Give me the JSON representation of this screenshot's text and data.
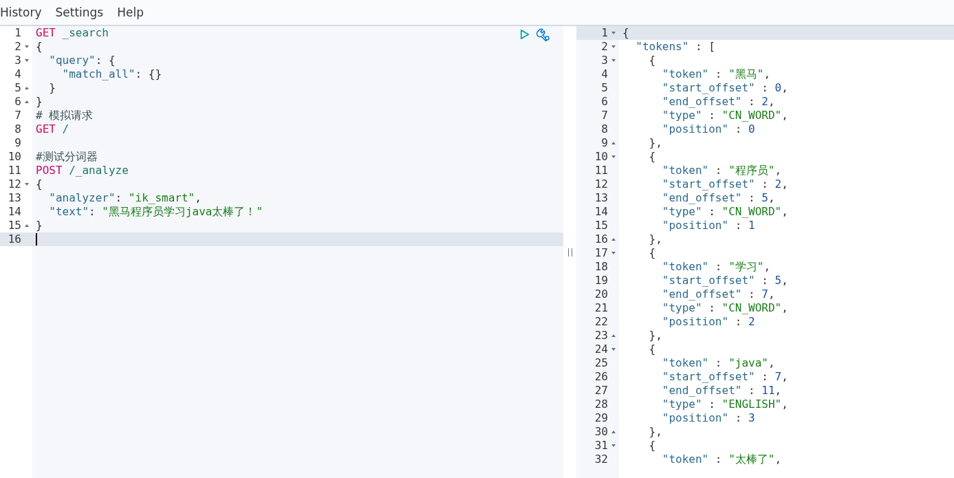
{
  "menu": [
    {
      "label": "History"
    },
    {
      "label": "Settings"
    },
    {
      "label": "Help"
    }
  ],
  "request": {
    "lines": [
      {
        "no": "1",
        "fold_start": false,
        "fold_end": false,
        "active": false,
        "segs": [
          {
            "kind": "method",
            "text": "GET"
          },
          {
            "kind": "path",
            "text": " _search"
          }
        ]
      },
      {
        "no": "2",
        "fold_start": true,
        "fold_end": false,
        "active": false,
        "segs": [
          {
            "kind": "punct",
            "text": "{"
          }
        ]
      },
      {
        "no": "3",
        "fold_start": true,
        "fold_end": false,
        "active": false,
        "segs": [
          {
            "kind": "key",
            "text": "  \"query\""
          },
          {
            "kind": "punct",
            "text": ": {"
          }
        ]
      },
      {
        "no": "4",
        "fold_start": false,
        "fold_end": false,
        "active": false,
        "segs": [
          {
            "kind": "key",
            "text": "    \"match_all\""
          },
          {
            "kind": "punct",
            "text": ": {}"
          }
        ]
      },
      {
        "no": "5",
        "fold_start": false,
        "fold_end": true,
        "active": false,
        "segs": [
          {
            "kind": "punct",
            "text": "  }"
          }
        ]
      },
      {
        "no": "6",
        "fold_start": false,
        "fold_end": true,
        "active": false,
        "segs": [
          {
            "kind": "punct",
            "text": "}"
          }
        ]
      },
      {
        "no": "7",
        "fold_start": false,
        "fold_end": false,
        "active": false,
        "segs": [
          {
            "kind": "comment",
            "text": "# 模拟请求"
          }
        ]
      },
      {
        "no": "8",
        "fold_start": false,
        "fold_end": false,
        "active": false,
        "segs": [
          {
            "kind": "method",
            "text": "GET"
          },
          {
            "kind": "path",
            "text": " /"
          }
        ]
      },
      {
        "no": "9",
        "fold_start": false,
        "fold_end": false,
        "active": false
      },
      {
        "no": "10",
        "fold_start": false,
        "fold_end": false,
        "active": false,
        "segs": [
          {
            "kind": "comment",
            "text": "#测试分词器"
          }
        ]
      },
      {
        "no": "11",
        "fold_start": false,
        "fold_end": false,
        "active": false,
        "segs": [
          {
            "kind": "method",
            "text": "POST"
          },
          {
            "kind": "path",
            "text": " /_analyze"
          }
        ]
      },
      {
        "no": "12",
        "fold_start": true,
        "fold_end": false,
        "active": false,
        "segs": [
          {
            "kind": "punct",
            "text": "{"
          }
        ]
      },
      {
        "no": "13",
        "fold_start": false,
        "fold_end": false,
        "active": false,
        "segs": [
          {
            "kind": "key",
            "text": "  \"analyzer\""
          },
          {
            "kind": "punct",
            "text": ": "
          },
          {
            "kind": "string",
            "text": "\"ik_smart\""
          },
          {
            "kind": "punct",
            "text": ","
          }
        ]
      },
      {
        "no": "14",
        "fold_start": false,
        "fold_end": false,
        "active": false,
        "segs": [
          {
            "kind": "key",
            "text": "  \"text\""
          },
          {
            "kind": "punct",
            "text": ": "
          },
          {
            "kind": "string",
            "text": "\"黑马程序员学习java太棒了！\""
          }
        ]
      },
      {
        "no": "15",
        "fold_start": false,
        "fold_end": true,
        "active": false,
        "segs": [
          {
            "kind": "punct",
            "text": "}"
          }
        ]
      },
      {
        "no": "16",
        "fold_start": false,
        "fold_end": false,
        "active": true
      }
    ]
  },
  "response": {
    "lines": [
      {
        "no": "1",
        "fold_start": true,
        "fold_end": false,
        "active": true,
        "segs": [
          {
            "kind": "punct",
            "text": "{"
          }
        ]
      },
      {
        "no": "2",
        "fold_start": true,
        "fold_end": false,
        "active": false,
        "segs": [
          {
            "kind": "key",
            "text": "  \"tokens\""
          },
          {
            "kind": "punct",
            "text": " : ["
          }
        ]
      },
      {
        "no": "3",
        "fold_start": true,
        "fold_end": false,
        "active": false,
        "segs": [
          {
            "kind": "punct",
            "text": "    {"
          }
        ]
      },
      {
        "no": "4",
        "fold_start": false,
        "fold_end": false,
        "active": false,
        "segs": [
          {
            "kind": "key",
            "text": "      \"token\""
          },
          {
            "kind": "punct",
            "text": " : "
          },
          {
            "kind": "string",
            "text": "\"黑马\""
          },
          {
            "kind": "punct",
            "text": ","
          }
        ]
      },
      {
        "no": "5",
        "fold_start": false,
        "fold_end": false,
        "active": false,
        "segs": [
          {
            "kind": "key",
            "text": "      \"start_offset\""
          },
          {
            "kind": "punct",
            "text": " : "
          },
          {
            "kind": "number",
            "text": "0"
          },
          {
            "kind": "punct",
            "text": ","
          }
        ]
      },
      {
        "no": "6",
        "fold_start": false,
        "fold_end": false,
        "active": false,
        "segs": [
          {
            "kind": "key",
            "text": "      \"end_offset\""
          },
          {
            "kind": "punct",
            "text": " : "
          },
          {
            "kind": "number",
            "text": "2"
          },
          {
            "kind": "punct",
            "text": ","
          }
        ]
      },
      {
        "no": "7",
        "fold_start": false,
        "fold_end": false,
        "active": false,
        "segs": [
          {
            "kind": "key",
            "text": "      \"type\""
          },
          {
            "kind": "punct",
            "text": " : "
          },
          {
            "kind": "string",
            "text": "\"CN_WORD\""
          },
          {
            "kind": "punct",
            "text": ","
          }
        ]
      },
      {
        "no": "8",
        "fold_start": false,
        "fold_end": false,
        "active": false,
        "segs": [
          {
            "kind": "key",
            "text": "      \"position\""
          },
          {
            "kind": "punct",
            "text": " : "
          },
          {
            "kind": "number",
            "text": "0"
          }
        ]
      },
      {
        "no": "9",
        "fold_start": false,
        "fold_end": true,
        "active": false,
        "segs": [
          {
            "kind": "punct",
            "text": "    },"
          }
        ]
      },
      {
        "no": "10",
        "fold_start": true,
        "fold_end": false,
        "active": false,
        "segs": [
          {
            "kind": "punct",
            "text": "    {"
          }
        ]
      },
      {
        "no": "11",
        "fold_start": false,
        "fold_end": false,
        "active": false,
        "segs": [
          {
            "kind": "key",
            "text": "      \"token\""
          },
          {
            "kind": "punct",
            "text": " : "
          },
          {
            "kind": "string",
            "text": "\"程序员\""
          },
          {
            "kind": "punct",
            "text": ","
          }
        ]
      },
      {
        "no": "12",
        "fold_start": false,
        "fold_end": false,
        "active": false,
        "segs": [
          {
            "kind": "key",
            "text": "      \"start_offset\""
          },
          {
            "kind": "punct",
            "text": " : "
          },
          {
            "kind": "number",
            "text": "2"
          },
          {
            "kind": "punct",
            "text": ","
          }
        ]
      },
      {
        "no": "13",
        "fold_start": false,
        "fold_end": false,
        "active": false,
        "segs": [
          {
            "kind": "key",
            "text": "      \"end_offset\""
          },
          {
            "kind": "punct",
            "text": " : "
          },
          {
            "kind": "number",
            "text": "5"
          },
          {
            "kind": "punct",
            "text": ","
          }
        ]
      },
      {
        "no": "14",
        "fold_start": false,
        "fold_end": false,
        "active": false,
        "segs": [
          {
            "kind": "key",
            "text": "      \"type\""
          },
          {
            "kind": "punct",
            "text": " : "
          },
          {
            "kind": "string",
            "text": "\"CN_WORD\""
          },
          {
            "kind": "punct",
            "text": ","
          }
        ]
      },
      {
        "no": "15",
        "fold_start": false,
        "fold_end": false,
        "active": false,
        "segs": [
          {
            "kind": "key",
            "text": "      \"position\""
          },
          {
            "kind": "punct",
            "text": " : "
          },
          {
            "kind": "number",
            "text": "1"
          }
        ]
      },
      {
        "no": "16",
        "fold_start": false,
        "fold_end": true,
        "active": false,
        "segs": [
          {
            "kind": "punct",
            "text": "    },"
          }
        ]
      },
      {
        "no": "17",
        "fold_start": true,
        "fold_end": false,
        "active": false,
        "segs": [
          {
            "kind": "punct",
            "text": "    {"
          }
        ]
      },
      {
        "no": "18",
        "fold_start": false,
        "fold_end": false,
        "active": false,
        "segs": [
          {
            "kind": "key",
            "text": "      \"token\""
          },
          {
            "kind": "punct",
            "text": " : "
          },
          {
            "kind": "string",
            "text": "\"学习\""
          },
          {
            "kind": "punct",
            "text": ","
          }
        ]
      },
      {
        "no": "19",
        "fold_start": false,
        "fold_end": false,
        "active": false,
        "segs": [
          {
            "kind": "key",
            "text": "      \"start_offset\""
          },
          {
            "kind": "punct",
            "text": " : "
          },
          {
            "kind": "number",
            "text": "5"
          },
          {
            "kind": "punct",
            "text": ","
          }
        ]
      },
      {
        "no": "20",
        "fold_start": false,
        "fold_end": false,
        "active": false,
        "segs": [
          {
            "kind": "key",
            "text": "      \"end_offset\""
          },
          {
            "kind": "punct",
            "text": " : "
          },
          {
            "kind": "number",
            "text": "7"
          },
          {
            "kind": "punct",
            "text": ","
          }
        ]
      },
      {
        "no": "21",
        "fold_start": false,
        "fold_end": false,
        "active": false,
        "segs": [
          {
            "kind": "key",
            "text": "      \"type\""
          },
          {
            "kind": "punct",
            "text": " : "
          },
          {
            "kind": "string",
            "text": "\"CN_WORD\""
          },
          {
            "kind": "punct",
            "text": ","
          }
        ]
      },
      {
        "no": "22",
        "fold_start": false,
        "fold_end": false,
        "active": false,
        "segs": [
          {
            "kind": "key",
            "text": "      \"position\""
          },
          {
            "kind": "punct",
            "text": " : "
          },
          {
            "kind": "number",
            "text": "2"
          }
        ]
      },
      {
        "no": "23",
        "fold_start": false,
        "fold_end": true,
        "active": false,
        "segs": [
          {
            "kind": "punct",
            "text": "    },"
          }
        ]
      },
      {
        "no": "24",
        "fold_start": true,
        "fold_end": false,
        "active": false,
        "segs": [
          {
            "kind": "punct",
            "text": "    {"
          }
        ]
      },
      {
        "no": "25",
        "fold_start": false,
        "fold_end": false,
        "active": false,
        "segs": [
          {
            "kind": "key",
            "text": "      \"token\""
          },
          {
            "kind": "punct",
            "text": " : "
          },
          {
            "kind": "string",
            "text": "\"java\""
          },
          {
            "kind": "punct",
            "text": ","
          }
        ]
      },
      {
        "no": "26",
        "fold_start": false,
        "fold_end": false,
        "active": false,
        "segs": [
          {
            "kind": "key",
            "text": "      \"start_offset\""
          },
          {
            "kind": "punct",
            "text": " : "
          },
          {
            "kind": "number",
            "text": "7"
          },
          {
            "kind": "punct",
            "text": ","
          }
        ]
      },
      {
        "no": "27",
        "fold_start": false,
        "fold_end": false,
        "active": false,
        "segs": [
          {
            "kind": "key",
            "text": "      \"end_offset\""
          },
          {
            "kind": "punct",
            "text": " : "
          },
          {
            "kind": "number",
            "text": "11"
          },
          {
            "kind": "punct",
            "text": ","
          }
        ]
      },
      {
        "no": "28",
        "fold_start": false,
        "fold_end": false,
        "active": false,
        "segs": [
          {
            "kind": "key",
            "text": "      \"type\""
          },
          {
            "kind": "punct",
            "text": " : "
          },
          {
            "kind": "string",
            "text": "\"ENGLISH\""
          },
          {
            "kind": "punct",
            "text": ","
          }
        ]
      },
      {
        "no": "29",
        "fold_start": false,
        "fold_end": false,
        "active": false,
        "segs": [
          {
            "kind": "key",
            "text": "      \"position\""
          },
          {
            "kind": "punct",
            "text": " : "
          },
          {
            "kind": "number",
            "text": "3"
          }
        ]
      },
      {
        "no": "30",
        "fold_start": false,
        "fold_end": true,
        "active": false,
        "segs": [
          {
            "kind": "punct",
            "text": "    },"
          }
        ]
      },
      {
        "no": "31",
        "fold_start": true,
        "fold_end": false,
        "active": false,
        "segs": [
          {
            "kind": "punct",
            "text": "    {"
          }
        ]
      },
      {
        "no": "32",
        "fold_start": false,
        "fold_end": false,
        "active": false,
        "segs": [
          {
            "kind": "key",
            "text": "      \"token\""
          },
          {
            "kind": "punct",
            "text": " : "
          },
          {
            "kind": "string",
            "text": "\"太棒了\""
          },
          {
            "kind": "punct",
            "text": ","
          }
        ]
      }
    ]
  }
}
